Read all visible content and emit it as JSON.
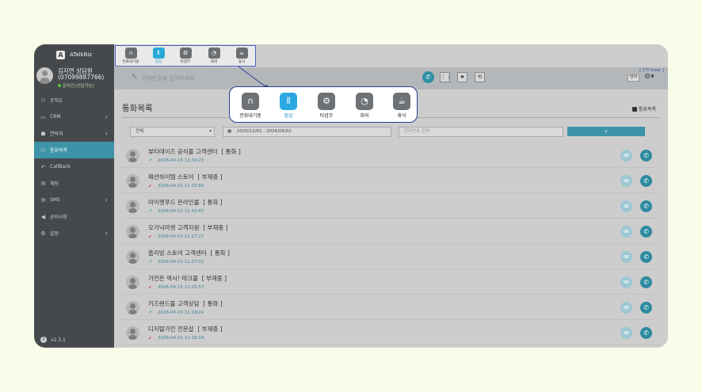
{
  "sidebar": {
    "brand": "ATalkBiz",
    "profile": {
      "name": "김지연 상담원",
      "phone": "(07099887766)",
      "status": "온라인(상담가능)"
    },
    "items": [
      {
        "label": "조직도",
        "icon": "org-icon",
        "has_chevron": false
      },
      {
        "label": "CRM",
        "icon": "crm-icon",
        "has_chevron": true
      },
      {
        "label": "연락처",
        "icon": "contact-icon",
        "has_chevron": true
      },
      {
        "label": "통화목록",
        "icon": "phone-list-icon",
        "has_chevron": false,
        "active": true
      },
      {
        "label": "CallBack",
        "icon": "callback-icon",
        "has_chevron": false
      },
      {
        "label": "채팅",
        "icon": "chat-icon",
        "has_chevron": false
      },
      {
        "label": "SMS",
        "icon": "sms-icon",
        "has_chevron": true
      },
      {
        "label": "공지사항",
        "icon": "notice-icon",
        "has_chevron": false
      },
      {
        "label": "설정",
        "icon": "settings-icon",
        "has_chevron": true
      }
    ],
    "version": "v2.3.1"
  },
  "topbar": {
    "phone_placeholder": "전화번호를 입력하세요",
    "cti_label": "[ CTI User ]",
    "online_label": "언어"
  },
  "toolbar": {
    "items": [
      {
        "label": "전화대기중",
        "icon": "headset-icon",
        "active": false
      },
      {
        "label": "점심",
        "icon": "utensils-icon",
        "active": true
      },
      {
        "label": "타업무",
        "icon": "cogs-icon",
        "active": false
      },
      {
        "label": "회의",
        "icon": "pie-chart-icon",
        "active": false
      },
      {
        "label": "휴식",
        "icon": "coffee-icon",
        "active": false
      }
    ]
  },
  "main": {
    "title": "통화목록",
    "export_label": "통화목록",
    "filter": {
      "category": "전체",
      "date_range": "2025/12/01 - 2026/06/02",
      "phone_placeholder": "전화번호 입력"
    },
    "calls": [
      {
        "name": "뷰티테이즈 공식몰 고객센터",
        "status": "통화",
        "time": "2026-04-15 11:34:23",
        "type": "outgoing"
      },
      {
        "name": "패션하이템 스토어",
        "status": "부재중",
        "time": "2026-04-15 11:33:50",
        "type": "missed"
      },
      {
        "name": "마이펫푸드 온라인몰",
        "status": "통화",
        "time": "2026-04-15 11:32:47",
        "type": "outgoing"
      },
      {
        "name": "오가닉마켓 고객지원",
        "status": "부재중",
        "time": "2026-04-15 11:27:27",
        "type": "missed"
      },
      {
        "name": "홈리빙 스토어 고객센터",
        "status": "통화",
        "time": "2026-04-15 11:27:01",
        "type": "outgoing"
      },
      {
        "name": "가전은 역시! 테크몰",
        "status": "부재중",
        "time": "2026-04-15 11:25:57",
        "type": "missed"
      },
      {
        "name": "키즈랜드몰 고객상담",
        "status": "통화",
        "time": "2026-04-15 11:18:24",
        "type": "outgoing"
      },
      {
        "name": "디지털가전 전문샵",
        "status": "부재중",
        "time": "2026-04-15 11:18:14",
        "type": "missed"
      }
    ]
  },
  "colors": {
    "accent": "#3d93a8",
    "active_status": "#2aa8e1",
    "sidebar_bg": "#46494c",
    "page_bg": "#f8fde9",
    "highlight_border": "#4d62c0"
  }
}
